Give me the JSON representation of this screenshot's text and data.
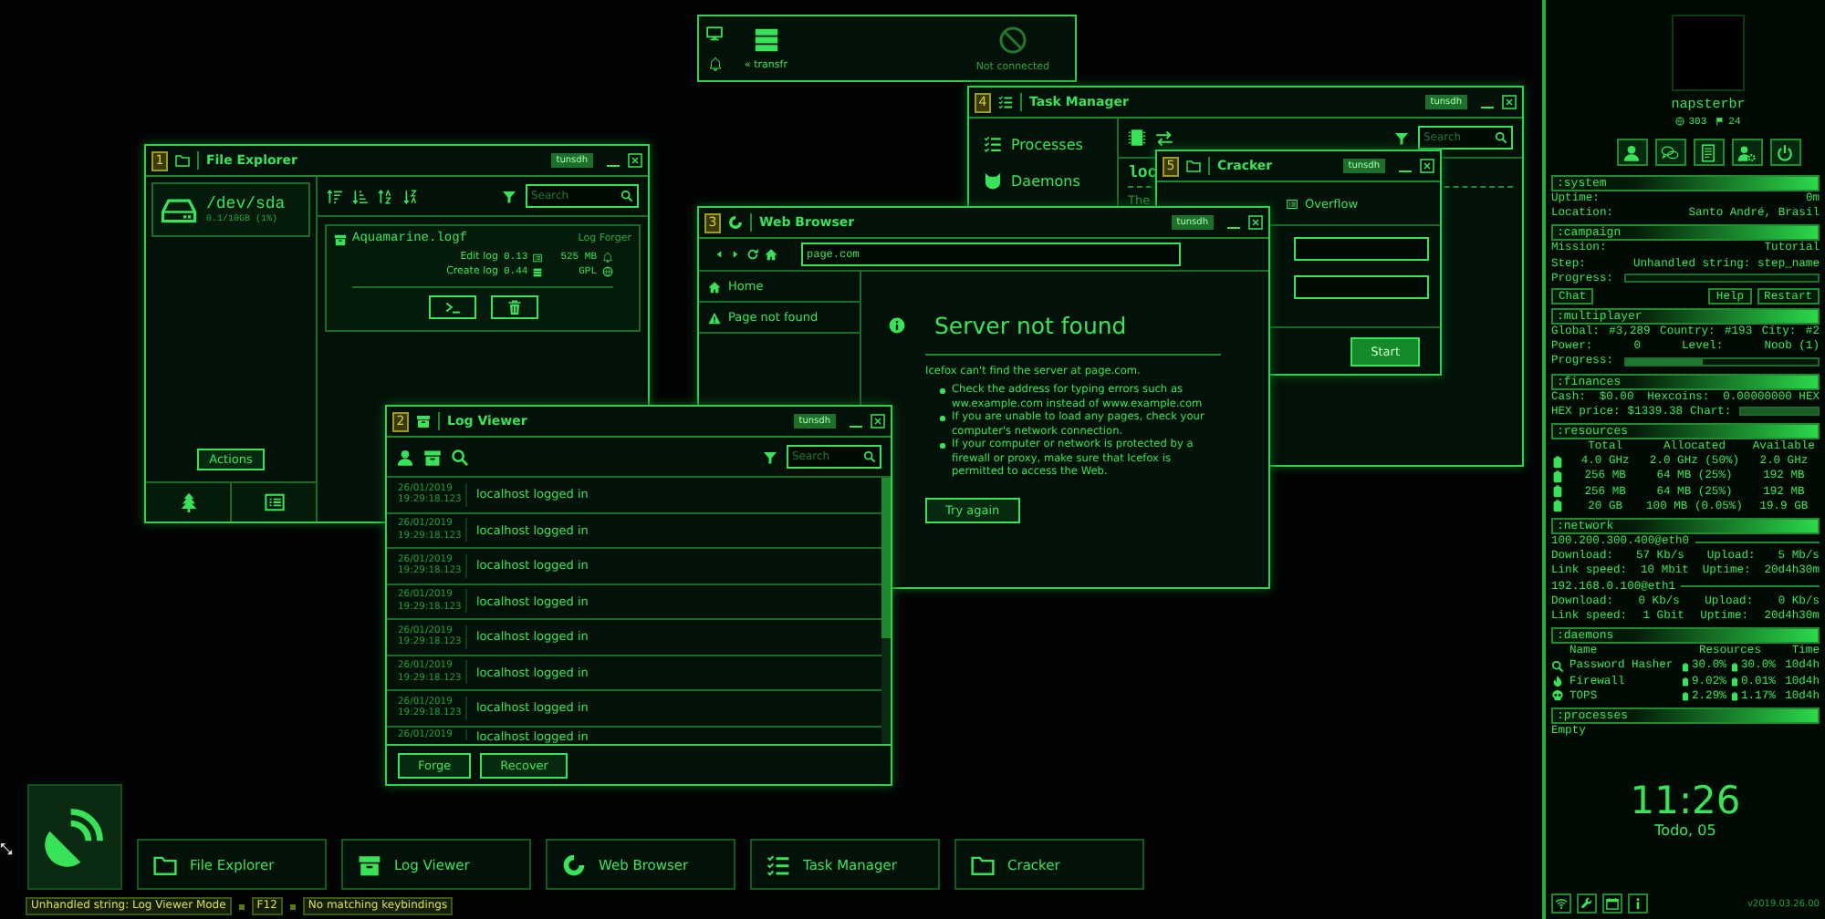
{
  "widget": {
    "transfer": "« transfr",
    "status": "Not connected"
  },
  "windows": [
    {
      "kind": "file_explorer",
      "number": "1",
      "title": "File Explorer",
      "badge": "tunsdh",
      "drive": {
        "path": "/dev/sda",
        "usage": "0.1/10GB (1%)"
      },
      "actions": "Actions",
      "search": {
        "placeholder": "Search"
      },
      "files": [
        {
          "name": "Aquamarine.logf",
          "software": "Log Forger",
          "modules": [
            {
              "name": "Edit log",
              "version": "0.13"
            },
            {
              "name": "Create log",
              "version": "0.44"
            }
          ],
          "size": "525 MB",
          "license": "GPL"
        }
      ]
    },
    {
      "kind": "task_manager",
      "number": "4",
      "title": "Task Manager",
      "badge": "tunsdh",
      "menu": [
        "Processes",
        "Daemons"
      ],
      "search": {
        "placeholder": "Search"
      },
      "content": [
        "loc",
        "The"
      ]
    },
    {
      "kind": "cracker",
      "number": "5",
      "title": "Cracker",
      "badge": "tunsdh",
      "tabs": [
        "Overflow"
      ],
      "button": "Start"
    },
    {
      "kind": "web_browser",
      "number": "3",
      "title": "Web Browser",
      "badge": "tunsdh",
      "address": "page.com",
      "tabs": [
        "Home",
        "Page not found"
      ],
      "page": {
        "title": "Server not found",
        "message": "Icefox can't find the server at page.com.",
        "bullets": [
          "Check the address for typing errors such as ww.example.com instead of www.example.com",
          "If you are unable to load any pages, check your computer's network connection.",
          "If your computer or network is protected by a firewall or proxy, make sure that Icefox is permitted to access the Web."
        ],
        "button": "Try again"
      }
    },
    {
      "kind": "log_viewer",
      "number": "2",
      "title": "Log Viewer",
      "badge": "tunsdh",
      "search": {
        "placeholder": "Search"
      },
      "entries": [
        {
          "date": "26/01/2019",
          "time": "19:29:18.123",
          "message": "localhost logged in"
        },
        {
          "date": "26/01/2019",
          "time": "19:29:18.123",
          "message": "localhost logged in"
        },
        {
          "date": "26/01/2019",
          "time": "19:29:18.123",
          "message": "localhost logged in"
        },
        {
          "date": "26/01/2019",
          "time": "19:29:18.123",
          "message": "localhost logged in"
        },
        {
          "date": "26/01/2019",
          "time": "19:29:18.123",
          "message": "localhost logged in"
        },
        {
          "date": "26/01/2019",
          "time": "19:29:18.123",
          "message": "localhost logged in"
        },
        {
          "date": "26/01/2019",
          "time": "19:29:18.123",
          "message": "localhost logged in"
        },
        {
          "date": "26/01/2019",
          "message": "localhost logged in"
        }
      ],
      "buttons": [
        "Forge",
        "Recover"
      ]
    }
  ],
  "taskbar": {
    "apps": [
      "File Explorer",
      "Log Viewer",
      "Web Browser",
      "Task Manager",
      "Cracker"
    ],
    "status": {
      "mode": "Unhandled string: Log Viewer Mode",
      "key": "F12",
      "message": "No matching keybindings"
    }
  },
  "sidebar": {
    "user": {
      "name": "napsterbr",
      "stats": [
        "303",
        "24"
      ]
    },
    "sections": [
      {
        "title": ":system",
        "rows": [
          {
            "kind": "pairs",
            "cells": [
              "Uptime:",
              "0m"
            ]
          },
          {
            "kind": "pairs",
            "cells": [
              "Location:",
              "Santo André, Brasil"
            ]
          }
        ]
      },
      {
        "title": ":campaign",
        "rows": [
          {
            "kind": "pairs",
            "cells": [
              "Mission:",
              "Tutorial"
            ]
          },
          {
            "kind": "pairs",
            "cells": [
              "Step:",
              "Unhandled string: step_name"
            ]
          },
          {
            "kind": "progress",
            "label": "Progress:",
            "level": 0
          },
          {
            "kind": "buttons",
            "buttons": [
              "Chat",
              "Help",
              "Restart"
            ]
          }
        ]
      },
      {
        "title": ":multiplayer",
        "rows": [
          {
            "kind": "pairs",
            "cells": [
              "Global:",
              "#3,289",
              "Country:",
              "#193",
              "City:",
              "#2"
            ]
          },
          {
            "kind": "pairs",
            "cells": [
              "Power:",
              "0",
              "Level:",
              "Noob (1)"
            ]
          },
          {
            "kind": "progress",
            "label": "Progress:",
            "level": 0.4
          }
        ]
      },
      {
        "title": ":finances",
        "rows": [
          {
            "kind": "pairs",
            "cells": [
              "Cash:",
              "$0.00",
              "Hexcoins:",
              "0.00000000 HEX"
            ]
          },
          {
            "kind": "chart",
            "cells": [
              "HEX price:",
              "$1339.38",
              "Chart:"
            ]
          }
        ]
      },
      {
        "title": ":resources",
        "rows": [
          {
            "kind": "resource_header",
            "cells": [
              "Total",
              "Allocated",
              "Available"
            ]
          },
          {
            "kind": "resource",
            "cells": [
              "4.0 GHz",
              "2.0 GHz (50%)",
              "2.0 GHz"
            ]
          },
          {
            "kind": "resource",
            "cells": [
              "256 MB",
              "64 MB (25%)",
              "192 MB"
            ]
          },
          {
            "kind": "resource",
            "cells": [
              "256 MB",
              "64 MB (25%)",
              "192 MB"
            ]
          },
          {
            "kind": "resource",
            "cells": [
              "20 GB",
              "100 MB (0.05%)",
              "19.9 GB"
            ]
          }
        ]
      },
      {
        "title": ":network",
        "rows": [
          {
            "kind": "address",
            "text": "100.200.300.400@eth0"
          },
          {
            "kind": "pairs",
            "cells": [
              "Download:",
              "57 Kb/s",
              "Upload:",
              "5 Mb/s"
            ]
          },
          {
            "kind": "pairs",
            "cells": [
              "Link speed:",
              "10 Mbit",
              "Uptime:",
              "20d4h30m"
            ]
          },
          {
            "kind": "address",
            "text": "192.168.0.100@eth1"
          },
          {
            "kind": "pairs",
            "cells": [
              "Download:",
              "0 Kb/s",
              "Upload:",
              "0 Kb/s"
            ]
          },
          {
            "kind": "pairs",
            "cells": [
              "Link speed:",
              "1 Gbit",
              "Uptime:",
              "20d4h30m"
            ]
          }
        ]
      },
      {
        "title": ":daemons",
        "rows": [
          {
            "kind": "daemon_header",
            "cells": [
              "Name",
              "Resources",
              "",
              "Time"
            ]
          },
          {
            "kind": "daemon",
            "cells": [
              "Password Hasher",
              "30.0%",
              "30.0%",
              "10d4h"
            ]
          },
          {
            "kind": "daemon",
            "cells": [
              "Firewall",
              "9.02%",
              "0.01%",
              "10d4h"
            ]
          },
          {
            "kind": "daemon",
            "cells": [
              "TOPS",
              "2.29%",
              "1.17%",
              "10d4h"
            ]
          }
        ]
      },
      {
        "title": ":processes",
        "rows": [
          {
            "kind": "text",
            "text": "Empty"
          }
        ]
      }
    ],
    "clock": {
      "time": "11:26",
      "date": "Todo, 05"
    },
    "version": "v2019.03.26.00"
  }
}
